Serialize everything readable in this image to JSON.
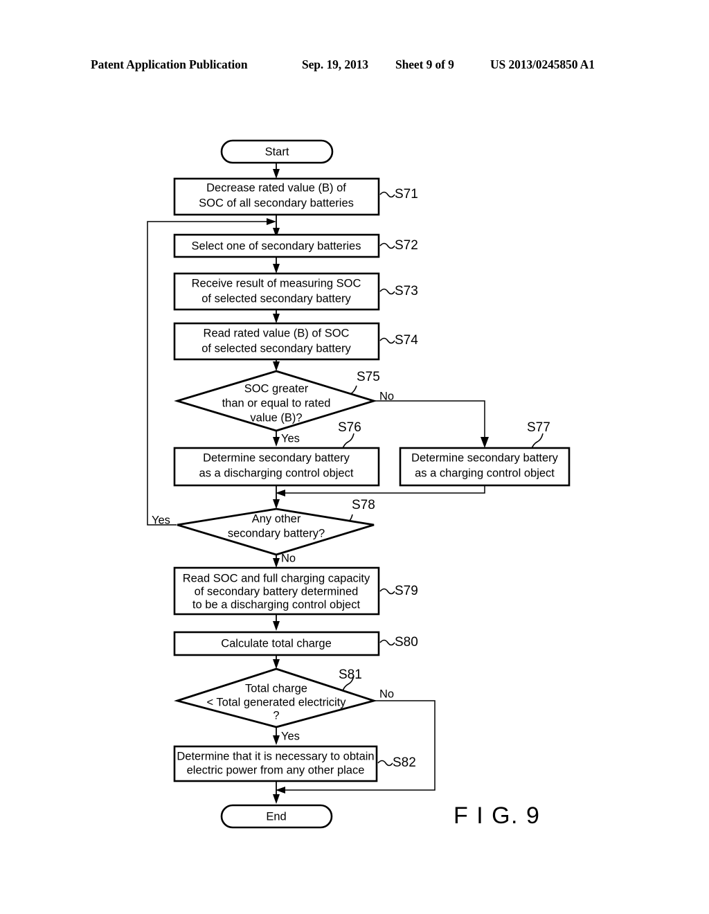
{
  "header": {
    "publication": "Patent Application Publication",
    "date": "Sep. 19, 2013",
    "sheet": "Sheet 9 of 9",
    "document_number": "US 2013/0245850 A1"
  },
  "figure": {
    "label": "F I G. 9"
  },
  "flowchart": {
    "start_label": "Start",
    "end_label": "End",
    "nodes": [
      {
        "id": "s71",
        "step": "S71",
        "type": "process",
        "lines": [
          "Decrease rated value (B) of",
          "SOC of all secondary batteries"
        ]
      },
      {
        "id": "s72",
        "step": "S72",
        "type": "process",
        "lines": [
          "Select one of secondary batteries"
        ]
      },
      {
        "id": "s73",
        "step": "S73",
        "type": "process",
        "lines": [
          "Receive result of measuring SOC",
          "of selected secondary battery"
        ]
      },
      {
        "id": "s74",
        "step": "S74",
        "type": "process",
        "lines": [
          "Read rated value (B) of SOC",
          "of selected secondary battery"
        ]
      },
      {
        "id": "s75",
        "step": "S75",
        "type": "decision",
        "lines": [
          "SOC greater",
          "than or equal to rated",
          "value (B)?"
        ],
        "yes_label": "Yes",
        "no_label": "No"
      },
      {
        "id": "s76",
        "step": "S76",
        "type": "process",
        "lines": [
          "Determine secondary battery",
          "as a discharging control object"
        ]
      },
      {
        "id": "s77",
        "step": "S77",
        "type": "process",
        "lines": [
          "Determine secondary battery",
          "as a charging control object"
        ]
      },
      {
        "id": "s78",
        "step": "S78",
        "type": "decision",
        "lines": [
          "Any other",
          "secondary battery?"
        ],
        "yes_label": "Yes",
        "no_label": "No"
      },
      {
        "id": "s79",
        "step": "S79",
        "type": "process",
        "lines": [
          "Read SOC and full charging capacity",
          "of secondary battery determined",
          "to be a discharging control object"
        ]
      },
      {
        "id": "s80",
        "step": "S80",
        "type": "process",
        "lines": [
          "Calculate total charge"
        ]
      },
      {
        "id": "s81",
        "step": "S81",
        "type": "decision",
        "lines": [
          "Total charge",
          "< Total generated electricity",
          "?"
        ],
        "yes_label": "Yes",
        "no_label": "No"
      },
      {
        "id": "s82",
        "step": "S82",
        "type": "process",
        "lines": [
          "Determine that it is necessary to obtain",
          "electric power from any other place"
        ]
      }
    ]
  }
}
